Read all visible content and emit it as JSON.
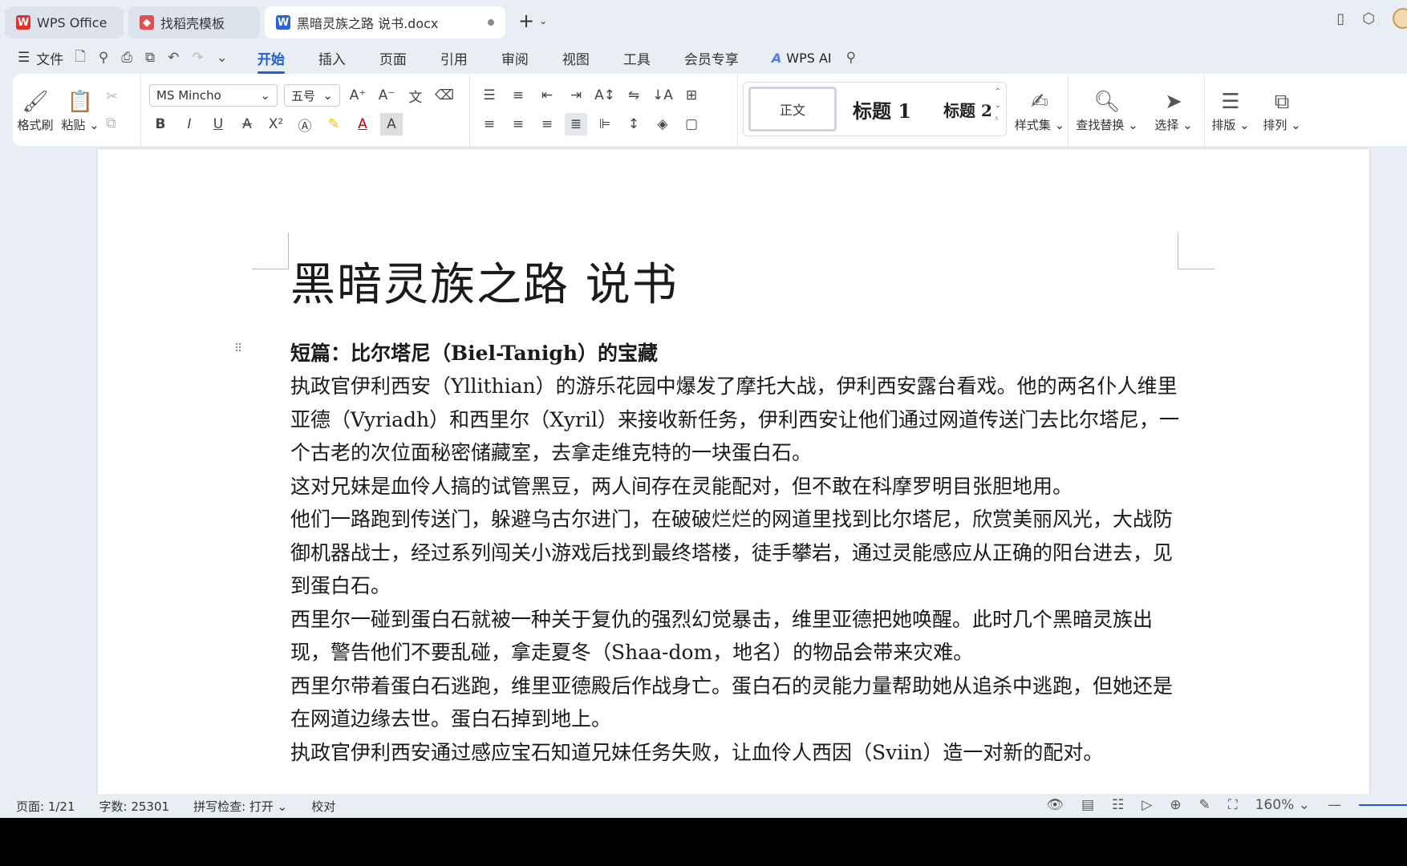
{
  "titlebar": {
    "tabs": [
      {
        "label": "WPS Office",
        "icon": "wps-logo-icon"
      },
      {
        "label": "找稻壳模板",
        "icon": "docer-icon"
      },
      {
        "label": "黑暗灵族之路 说书.docx",
        "icon": "word-doc-icon"
      }
    ],
    "new_tab": "+"
  },
  "menubar": {
    "file_label": "文件",
    "tabs": [
      "开始",
      "插入",
      "页面",
      "引用",
      "审阅",
      "视图",
      "工具",
      "会员专享"
    ],
    "active_tab": "开始",
    "ai_label": "WPS AI"
  },
  "ribbon": {
    "format_painter": "格式刷",
    "paste": "粘贴",
    "font_name": "MS Mincho",
    "font_size": "五号",
    "styles": {
      "normal": "正文",
      "heading1": "标题 1",
      "heading2": "标题 2"
    },
    "style_set": "样式集",
    "find_replace": "查找替换",
    "select": "选择",
    "layout": "排版",
    "arrange": "排列"
  },
  "document": {
    "title": "黑暗灵族之路 说书",
    "subtitle": "短篇：比尔塔尼（Biel-Tanigh）的宝藏",
    "paragraphs": [
      "执政官伊利西安（Yllithian）的游乐花园中爆发了摩托大战，伊利西安露台看戏。他的两名仆人维里亚德（Vyriadh）和西里尔（Xyril）来接收新任务，伊利西安让他们通过网道传送门去比尔塔尼，一个古老的次位面秘密储藏室，去拿走维克特的一块蛋白石。",
      "这对兄妹是血伶人搞的试管黑豆，两人间存在灵能配对，但不敢在科摩罗明目张胆地用。",
      "他们一路跑到传送门，躲避乌古尔进门，在破破烂烂的网道里找到比尔塔尼，欣赏美丽风光，大战防御机器战士，经过系列闯关小游戏后找到最终塔楼，徒手攀岩，通过灵能感应从正确的阳台进去，见到蛋白石。",
      "西里尔一碰到蛋白石就被一种关于复仇的强烈幻觉暴击，维里亚德把她唤醒。此时几个黑暗灵族出现，警告他们不要乱碰，拿走夏冬（Shaa-dom，地名）的物品会带来灾难。",
      "西里尔带着蛋白石逃跑，维里亚德殿后作战身亡。蛋白石的灵能力量帮助她从追杀中逃跑，但她还是在网道边缘去世。蛋白石掉到地上。",
      "执政官伊利西安通过感应宝石知道兄妹任务失败，让血伶人西因（Sviin）造一对新的配对。"
    ]
  },
  "statusbar": {
    "page": "页面: 1/21",
    "words": "字数: 25301",
    "spell": "拼写检查: 打开",
    "proof": "校对",
    "zoom": "160%"
  }
}
